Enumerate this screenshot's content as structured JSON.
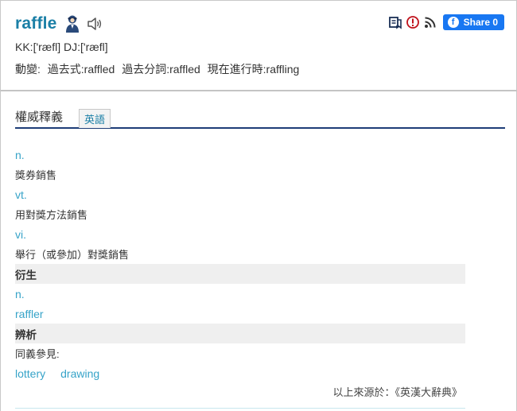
{
  "header": {
    "word": "raffle",
    "pronunciation": "KK:['ræfl] DJ:['ræfl]",
    "forms": {
      "label": "動變:",
      "past": "過去式:raffled",
      "past_participle": "過去分詞:raffled",
      "present_participle": "現在進行時:raffling"
    },
    "share_label": "Share 0",
    "icons": [
      "person-icon",
      "speaker-icon",
      "bookmark-icon",
      "alert-icon",
      "rss-icon",
      "facebook-icon"
    ]
  },
  "tabs": {
    "title": "權威釋義",
    "active": "英語"
  },
  "entries": [
    {
      "kind": "pos",
      "text": "n."
    },
    {
      "kind": "def",
      "text": "獎券銷售"
    },
    {
      "kind": "pos",
      "text": "vt."
    },
    {
      "kind": "def",
      "text": "用對獎方法銷售"
    },
    {
      "kind": "pos",
      "text": "vi."
    },
    {
      "kind": "def",
      "text": "舉行（或參加）對獎銷售"
    },
    {
      "kind": "section",
      "text": "衍生"
    },
    {
      "kind": "pos",
      "text": "n."
    },
    {
      "kind": "link",
      "text": "raffler"
    },
    {
      "kind": "section",
      "text": "辨析"
    },
    {
      "kind": "def",
      "text": "同義參見:"
    }
  ],
  "synonyms": [
    "lottery",
    "drawing"
  ],
  "source": "以上來源於：《英漢大辭典》",
  "colors": {
    "word": "#1a7fa6",
    "link": "#36a3c8",
    "tab_rule": "#1e3d78",
    "section_bg": "#efefef",
    "facebook": "#1877f2"
  }
}
